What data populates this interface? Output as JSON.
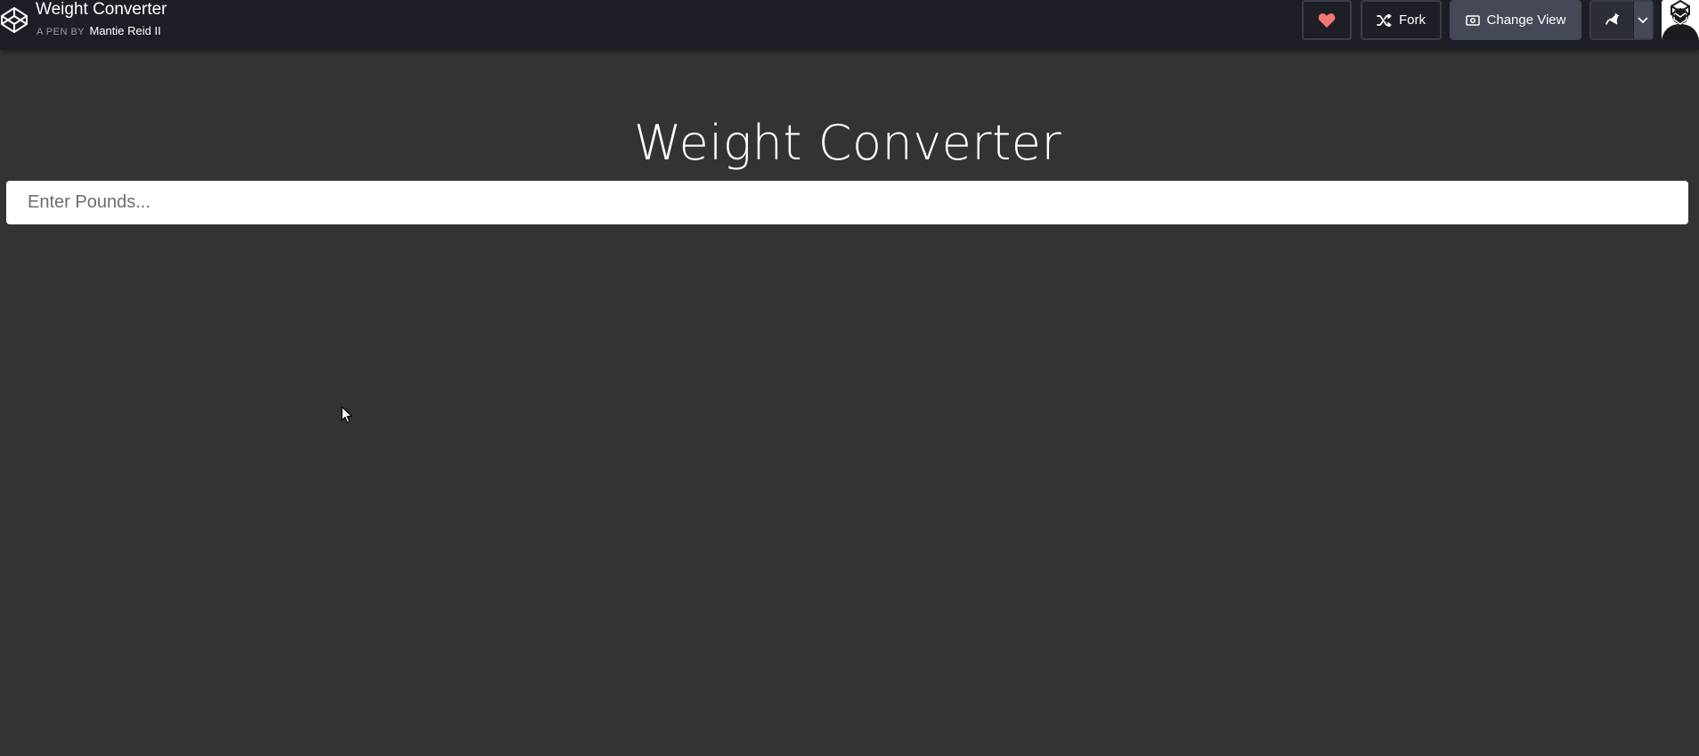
{
  "header": {
    "pen_title": "Weight Converter",
    "byline_prefix": "A PEN BY",
    "author": "Mantie Reid II",
    "buttons": {
      "heart_icon": "heart-icon",
      "fork_label": "Fork",
      "change_view_label": "Change View"
    },
    "heart_color": "#f37575"
  },
  "main": {
    "title": "Weight Converter",
    "pounds_placeholder": "Enter Pounds...",
    "pounds_value": ""
  },
  "colors": {
    "background": "#333333",
    "topbar": "#1e1f26",
    "active_button": "#444857"
  }
}
